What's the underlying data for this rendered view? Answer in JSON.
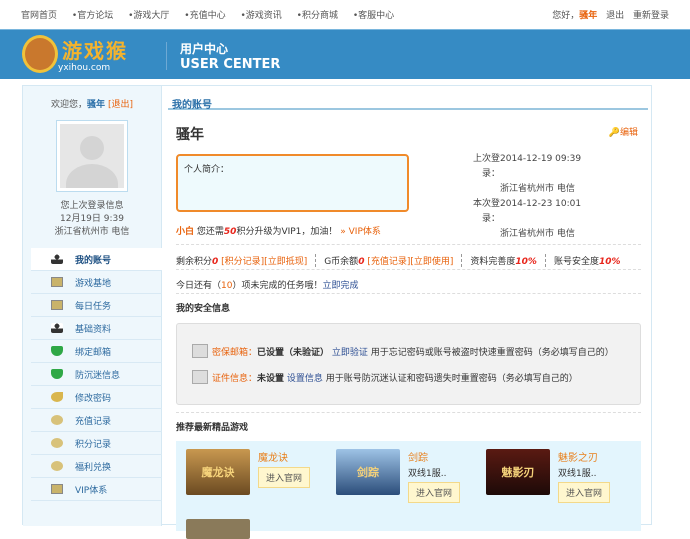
{
  "topnav": {
    "links": [
      "官网首页",
      "•官方论坛",
      "•游戏大厅",
      "•充值中心",
      "•游戏资讯",
      "•积分商城",
      "•客服中心"
    ],
    "greeting": "您好，",
    "username": "骚年",
    "logout": "退出",
    "relogin": "重新登录"
  },
  "banner": {
    "logo_text": "游戏猴",
    "logo_url": "yxihou.com",
    "title_cn": "用户中心",
    "title_en": "USER CENTER"
  },
  "sidebar": {
    "welcome": "欢迎您，",
    "username": "骚年",
    "logout": "[退出]",
    "login_label": "您上次登录信息",
    "login_time": "12月19日 9:39",
    "login_loc": "浙江省杭州市 电信",
    "items": [
      {
        "label": "我的账号",
        "icon": "user"
      },
      {
        "label": "游戏基地",
        "icon": "card"
      },
      {
        "label": "每日任务",
        "icon": "card"
      },
      {
        "label": "基础资料",
        "icon": "user"
      },
      {
        "label": "绑定邮箱",
        "icon": "shield"
      },
      {
        "label": "防沉迷信息",
        "icon": "shield"
      },
      {
        "label": "修改密码",
        "icon": "key"
      },
      {
        "label": "充值记录",
        "icon": "medal"
      },
      {
        "label": "积分记录",
        "icon": "medal"
      },
      {
        "label": "福利兑换",
        "icon": "medal"
      },
      {
        "label": "VIP体系",
        "icon": "card"
      }
    ]
  },
  "main": {
    "header": "我的账号",
    "name": "骚年",
    "edit": "编辑",
    "intro_label": "个人简介：",
    "last_login_label": "上次登录：",
    "last_login_time": "2014-12-19 09:39",
    "last_login_loc": "浙江省杭州市 电信",
    "this_login_label": "本次登录：",
    "this_login_time": "2014-12-23 10:01",
    "this_login_loc": "浙江省杭州市 电信",
    "vip": {
      "level": "小白",
      "pre": "您还需",
      "points": "50",
      "post": "积分升级为VIP1，加油！",
      "link": "» VIP体系"
    },
    "stats": {
      "points_label": "剩余积分",
      "points": "0",
      "points_links": "[积分记录][立即抵现]",
      "gcoin_label": "G币余额",
      "gcoin": "0",
      "gcoin_links": "[充值记录][立即使用]",
      "profile_label": "资料完善度",
      "profile": "10%",
      "security_label": "账号安全度",
      "security": "10%"
    },
    "task": {
      "pre": "今日还有（",
      "count": "10",
      "post": "）项未完成的任务哦！",
      "link": "立即完成"
    },
    "security": {
      "title": "我的安全信息",
      "email": {
        "label": "密保邮箱：",
        "status": "已设置（未验证）",
        "link": "立即验证",
        "desc": "用于忘记密码或账号被盗时快速重置密码（务必填写自己的）"
      },
      "id": {
        "label": "证件信息：",
        "status": "未设置",
        "link": "设置信息",
        "desc": "用于账号防沉迷认证和密码遗失时重置密码（务必填写自己的）"
      }
    },
    "games_title": "推荐最新精品游戏",
    "games": [
      {
        "title": "魔龙诀",
        "sub": "",
        "button": "进入官网",
        "thumb": "魔龙诀"
      },
      {
        "title": "剑踪",
        "sub": "双线1服..",
        "button": "进入官网",
        "thumb": "剑踪"
      },
      {
        "title": "魅影之刃",
        "sub": "双线1服..",
        "button": "进入官网",
        "thumb": "魅影刃"
      }
    ]
  }
}
